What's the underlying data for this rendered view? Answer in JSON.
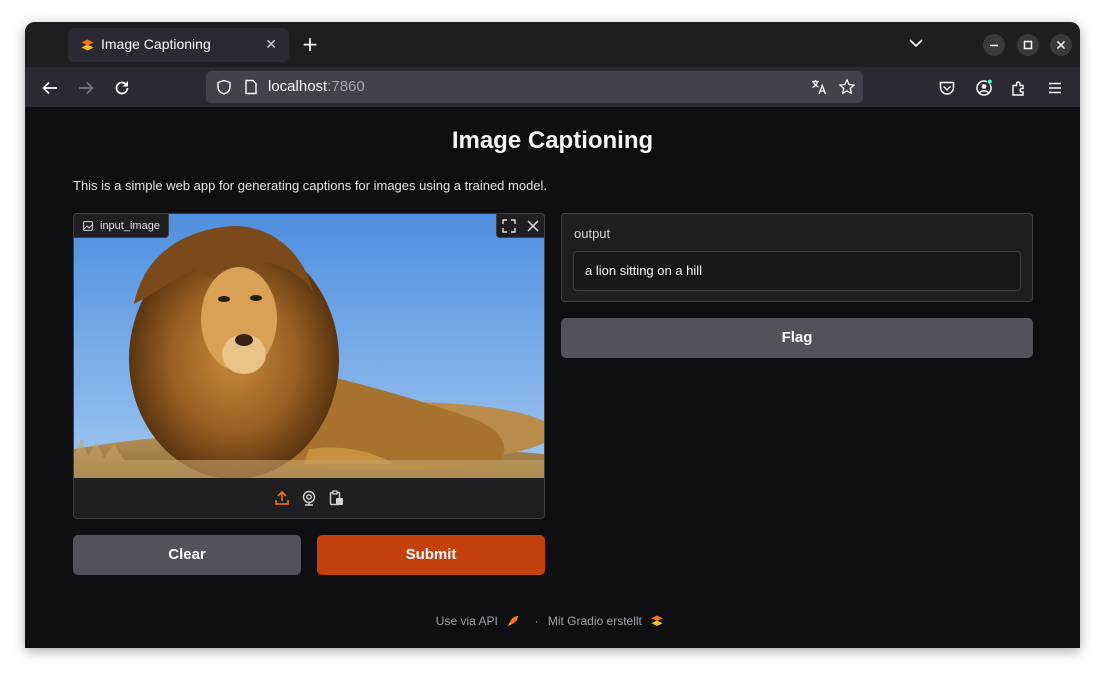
{
  "browser": {
    "tab_title": "Image Captioning",
    "new_tab_symbol": "+",
    "tab_close_symbol": "✕",
    "url_host": "localhost",
    "url_port": ":7860"
  },
  "page": {
    "title": "Image Captioning",
    "description": "This is a simple web app for generating captions for images using a trained model."
  },
  "input_image": {
    "label": "input_image"
  },
  "output": {
    "label": "output",
    "value": "a lion sitting on a hill"
  },
  "buttons": {
    "flag": "Flag",
    "clear": "Clear",
    "submit": "Submit"
  },
  "footer": {
    "api_link": "Use via API",
    "separator": "·",
    "gradio_link": "Mit Gradio erstellt"
  },
  "colors": {
    "accent": "#c2410c",
    "secondary_button": "#52525b",
    "upload_icon": "#f97316"
  }
}
